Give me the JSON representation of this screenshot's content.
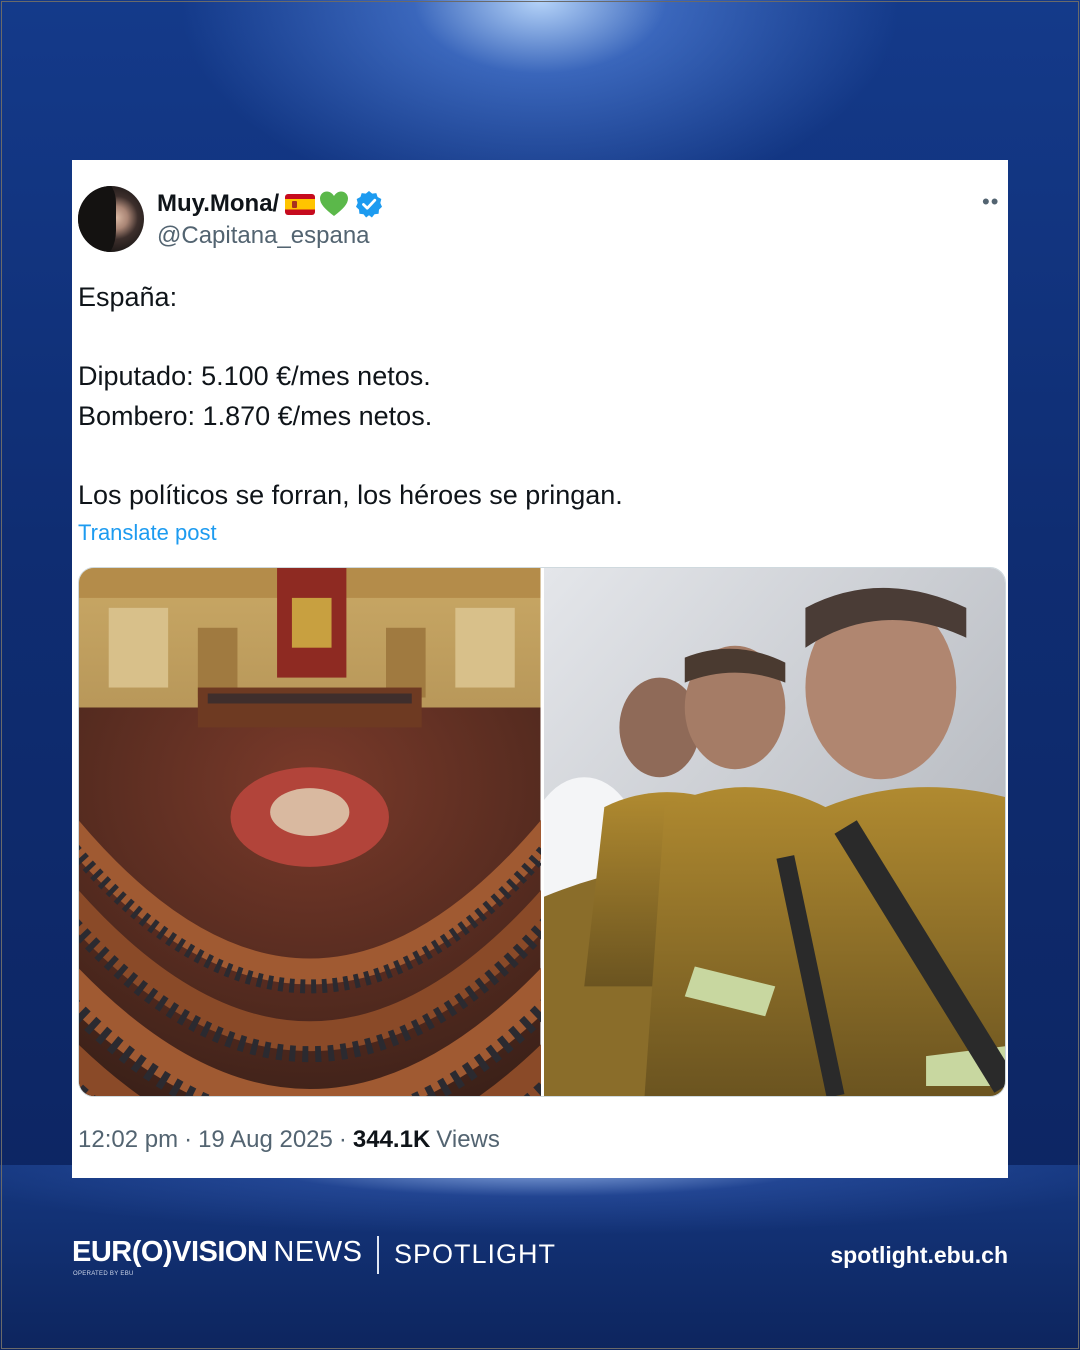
{
  "post": {
    "display_name": "Muy.Mona/",
    "name_emojis": [
      "spain-flag-icon",
      "green-heart-icon",
      "verified-badge-icon"
    ],
    "handle": "@Capitana_espana",
    "text_lines": [
      "España:",
      "Diputado: 5.100 €/mes netos.",
      "Bombero: 1.870 €/mes netos.",
      "Los políticos se forran, los héroes se pringan."
    ],
    "translate_label": "Translate post",
    "time": "12:02 pm",
    "date": "19 Aug 2025",
    "views_count": "344.1K",
    "views_label": "Views",
    "separator": "·"
  },
  "footer": {
    "brand": "EUR(O)VISION",
    "brand_suffix": "NEWS",
    "brand_sub": "OPERATED BY EBU",
    "program": "SPOTLIGHT",
    "site": "spotlight.ebu.ch"
  },
  "colors": {
    "background": "#0e2a66",
    "link": "#1d9bf0",
    "secondary_text": "#536471",
    "verified": "#1d9bf0"
  }
}
